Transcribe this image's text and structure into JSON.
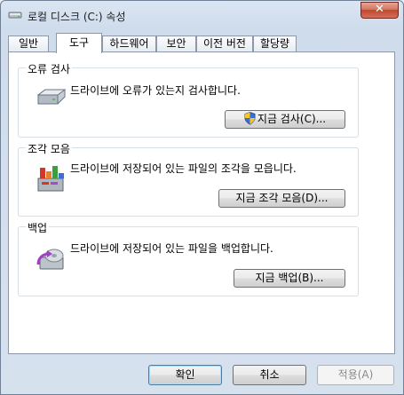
{
  "window": {
    "title": "로컬 디스크 (C:) 속성",
    "close_label": "✕"
  },
  "tabs": [
    {
      "label": "일반"
    },
    {
      "label": "도구",
      "active": true
    },
    {
      "label": "하드웨어"
    },
    {
      "label": "보안"
    },
    {
      "label": "이전 버전"
    },
    {
      "label": "할당량"
    }
  ],
  "error_check": {
    "title": "오류 검사",
    "description": "드라이브에 오류가 있는지 검사합니다.",
    "button": "지금 검사(C)...",
    "icon": "hard-drive-icon"
  },
  "defrag": {
    "title": "조각 모음",
    "description": "드라이브에 저장되어 있는 파일의 조각을 모읍니다.",
    "button": "지금 조각 모음(D)...",
    "icon": "defragment-icon"
  },
  "backup": {
    "title": "백업",
    "description": "드라이브에 저장되어 있는 파일을 백업합니다.",
    "button": "지금 백업(B)...",
    "icon": "backup-icon"
  },
  "footer": {
    "ok": "확인",
    "cancel": "취소",
    "apply": "적용(A)"
  }
}
